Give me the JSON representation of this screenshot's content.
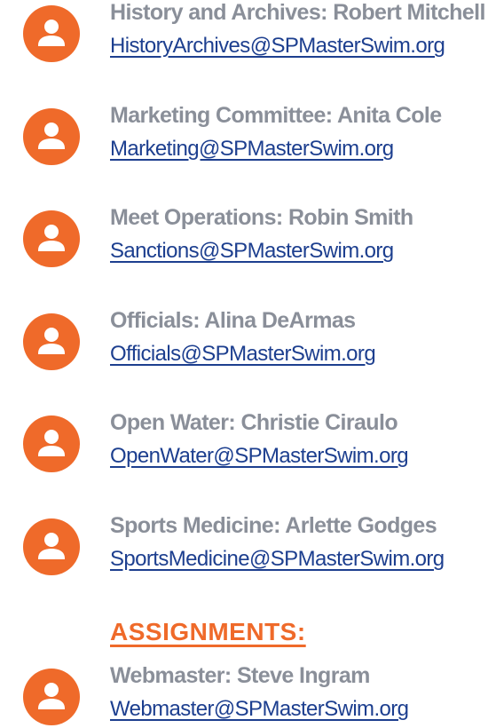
{
  "colors": {
    "accent": "#ef6a2a",
    "role_text": "#8a8f99",
    "link": "#1d3f8f"
  },
  "icons": {
    "avatar": "user-icon"
  },
  "contacts": [
    {
      "role": "History and Archives: Robert Mitchell",
      "email": "HistoryArchives@SPMasterSwim.org"
    },
    {
      "role": "Marketing Committee: Anita Cole",
      "email": "Marketing@SPMasterSwim.org"
    },
    {
      "role": "Meet Operations: Robin Smith",
      "email": "Sanctions@SPMasterSwim.org"
    },
    {
      "role": "Officials: Alina DeArmas",
      "email": "Officials@SPMasterSwim.org"
    },
    {
      "role": "Open Water: Christie Ciraulo",
      "email": "OpenWater@SPMasterSwim.org"
    },
    {
      "role": "Sports Medicine: Arlette Godges",
      "email": "SportsMedicine@SPMasterSwim.org"
    }
  ],
  "assignments": {
    "heading": "ASSIGNMENTS:",
    "contacts": [
      {
        "role": "Webmaster: Steve Ingram",
        "email": "Webmaster@SPMasterSwim.org"
      }
    ]
  }
}
